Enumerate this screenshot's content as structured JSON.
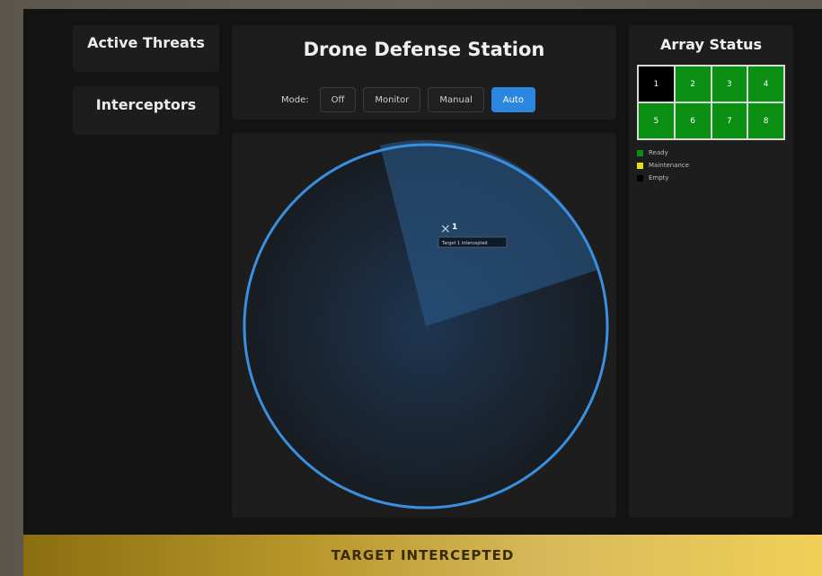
{
  "side": {
    "threats_label": "Active Threats",
    "interceptors_label": "Interceptors"
  },
  "header": {
    "title": "Drone Defense Station",
    "mode_label": "Mode:",
    "modes": [
      "Off",
      "Monitor",
      "Manual",
      "Auto"
    ],
    "active_mode": "Auto"
  },
  "radar": {
    "target_marker": "×",
    "target_id": "1",
    "target_label": "Target 1 intercepted",
    "colors": {
      "ring": "#3b8fe0",
      "sweep": "#2a5a8a"
    }
  },
  "array": {
    "title": "Array Status",
    "cells": [
      {
        "label": "1",
        "status": "empty"
      },
      {
        "label": "2",
        "status": "ready"
      },
      {
        "label": "3",
        "status": "ready"
      },
      {
        "label": "4",
        "status": "ready"
      },
      {
        "label": "5",
        "status": "ready"
      },
      {
        "label": "6",
        "status": "ready"
      },
      {
        "label": "7",
        "status": "ready"
      },
      {
        "label": "8",
        "status": "ready"
      }
    ],
    "legend": [
      {
        "label": "Ready",
        "color": "#0a8f12"
      },
      {
        "label": "Maintenance",
        "color": "#e4e014"
      },
      {
        "label": "Empty",
        "color": "#000000"
      }
    ]
  },
  "banner": {
    "text": "TARGET INTERCEPTED"
  }
}
